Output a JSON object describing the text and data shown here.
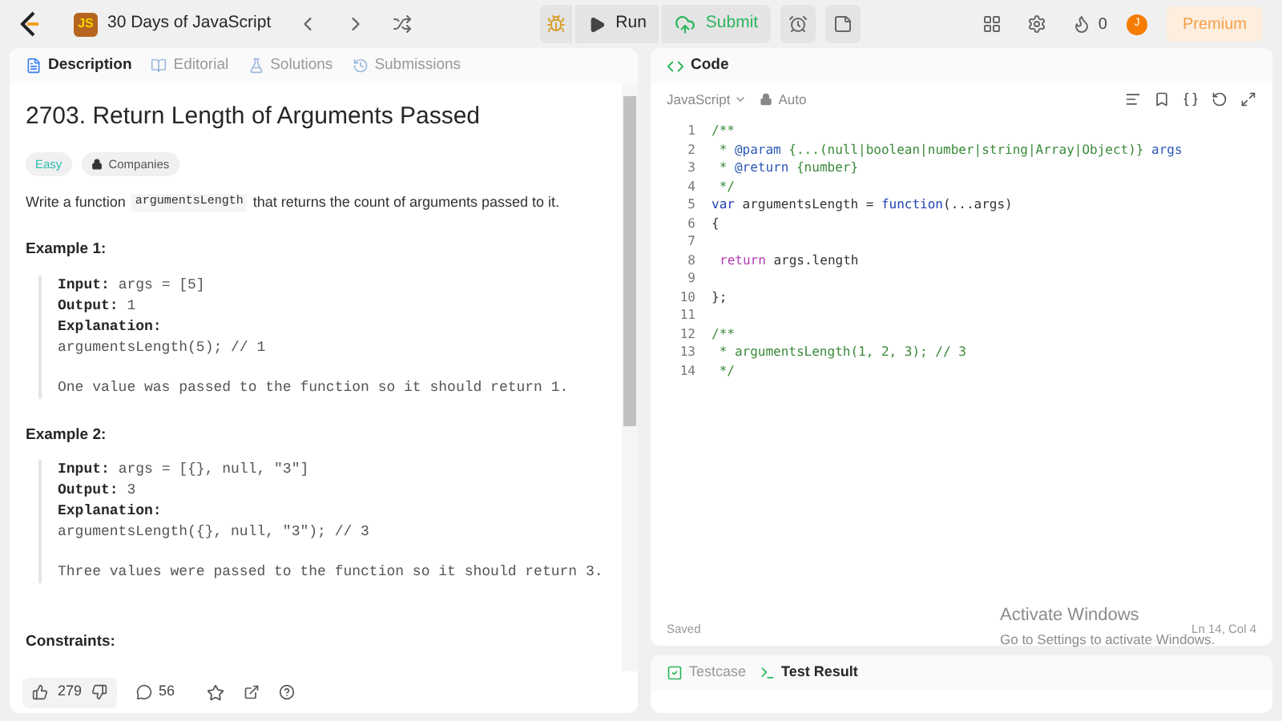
{
  "topbar": {
    "title": "30 Days of JavaScript",
    "logo_text": "JS",
    "run": "Run",
    "submit": "Submit",
    "streak": "0",
    "avatar": "J",
    "premium": "Premium"
  },
  "left": {
    "tabs": [
      {
        "label": "Description",
        "selected": true
      },
      {
        "label": "Editorial",
        "selected": false
      },
      {
        "label": "Solutions",
        "selected": false
      },
      {
        "label": "Submissions",
        "selected": false
      }
    ],
    "title": "2703. Return Length of Arguments Passed",
    "difficulty": "Easy",
    "companies": "Companies",
    "intro_before": "Write a function",
    "intro_code": "argumentsLength",
    "intro_after": "that returns the count of arguments passed to it.",
    "examples": [
      {
        "heading": "Example 1:",
        "input_label": "Input:",
        "input": "args = [5]",
        "output_label": "Output:",
        "output": "1",
        "explanation_label": "Explanation:",
        "code": "argumentsLength(5); // 1",
        "note": "One value was passed to the function so it should return 1."
      },
      {
        "heading": "Example 2:",
        "input_label": "Input:",
        "input": "args = [{}, null, \"3\"]",
        "output_label": "Output:",
        "output": "3",
        "explanation_label": "Explanation:",
        "code": "argumentsLength({}, null, \"3\"); // 3",
        "note": "Three values were passed to the function so it should return 3."
      }
    ],
    "constraints": "Constraints:",
    "likes": "279",
    "comments": "56"
  },
  "right": {
    "tab": "Code",
    "language": "JavaScript",
    "mode": "Auto",
    "lines": [
      {
        "number": "1",
        "tokens": [
          {
            "kind": "comment",
            "text": "/**"
          }
        ]
      },
      {
        "number": "2",
        "tokens": [
          {
            "kind": "comment",
            "text": " * "
          },
          {
            "kind": "tag",
            "text": "@param"
          },
          {
            "kind": "comment",
            "text": " {...(null|boolean|number|string|Array|Object)} "
          },
          {
            "kind": "tag",
            "text": "args"
          }
        ]
      },
      {
        "number": "3",
        "tokens": [
          {
            "kind": "comment",
            "text": " * "
          },
          {
            "kind": "tag",
            "text": "@return"
          },
          {
            "kind": "comment",
            "text": " {number}"
          }
        ]
      },
      {
        "number": "4",
        "tokens": [
          {
            "kind": "comment",
            "text": " */"
          }
        ]
      },
      {
        "number": "5",
        "tokens": [
          {
            "kind": "keyword",
            "text": "var"
          },
          {
            "kind": "plain",
            "text": " argumentsLength = "
          },
          {
            "kind": "keyword",
            "text": "function"
          },
          {
            "kind": "plain",
            "text": "(...args)"
          }
        ]
      },
      {
        "number": "6",
        "tokens": [
          {
            "kind": "plain",
            "text": "{"
          }
        ]
      },
      {
        "number": "7"
      },
      {
        "number": "8",
        "indent": true,
        "tokens": [
          {
            "kind": "control",
            "text": "return"
          },
          {
            "kind": "plain",
            "text": " args.length"
          }
        ]
      },
      {
        "number": "9"
      },
      {
        "number": "10",
        "tokens": [
          {
            "kind": "plain",
            "text": "};"
          }
        ]
      },
      {
        "number": "11"
      },
      {
        "number": "12",
        "tokens": [
          {
            "kind": "comment",
            "text": "/**"
          }
        ]
      },
      {
        "number": "13",
        "tokens": [
          {
            "kind": "comment",
            "text": " * argumentsLength(1, 2, 3); // 3"
          }
        ]
      },
      {
        "number": "14",
        "tokens": [
          {
            "kind": "comment",
            "text": " */"
          }
        ]
      }
    ],
    "status": "Saved",
    "cursor": "Ln 14, Col 4",
    "bottom_tabs": [
      {
        "label": "Testcase",
        "selected": false,
        "kind": "check"
      },
      {
        "label": "Test Result",
        "selected": true,
        "kind": "terminal"
      }
    ]
  },
  "overlay": {
    "title": "Activate Windows",
    "subtitle": "Go to Settings to activate Windows."
  }
}
